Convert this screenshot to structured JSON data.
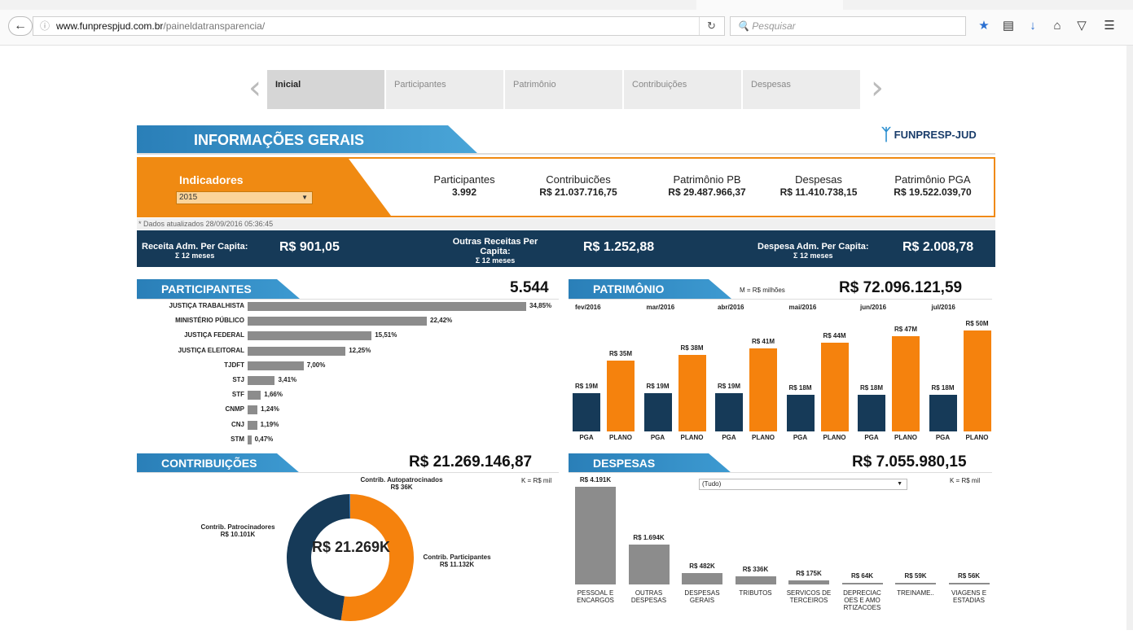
{
  "browser": {
    "url_host": "www.funprespjud.com.br",
    "url_path": "/paineldatransparencia/",
    "search_placeholder": "Pesquisar"
  },
  "nav": {
    "tabs": [
      "Inicial",
      "Participantes",
      "Patrimônio",
      "Contribuições",
      "Despesas"
    ],
    "active": "Inicial"
  },
  "header": {
    "title": "INFORMAÇÕES GERAIS",
    "logo": "FUNPRESP-JUD"
  },
  "indicators": {
    "label": "Indicadores",
    "year": "2015",
    "metrics": [
      {
        "label": "Participantes",
        "value": "3.992"
      },
      {
        "label": "Contribuicões",
        "value": "R$ 21.037.716,75"
      },
      {
        "label": "Patrimônio PB",
        "value": "R$ 29.487.966,37"
      },
      {
        "label": "Despesas",
        "value": "R$ 11.410.738,15"
      },
      {
        "label": "Patrimônio PGA",
        "value": "R$ 19.522.039,70"
      }
    ],
    "updated": "* Dados atualizados  28/09/2016 05:36:45"
  },
  "per_capita": {
    "receita_label": "Receita Adm. Per Capita:",
    "receita_sub": "Σ 12 meses",
    "receita_value": "R$ 901,05",
    "outras_label": "Outras Receitas Per Capita:",
    "outras_sub": "Σ 12 meses",
    "outras_value": "R$ 1.252,88",
    "despesa_label": "Despesa Adm. Per Capita:",
    "despesa_sub": "Σ 12 meses",
    "despesa_value": "R$ 2.008,78"
  },
  "participantes": {
    "title": "PARTICIPANTES",
    "total": "5.544",
    "chart_data": {
      "type": "bar",
      "categories": [
        "JUSTIÇA TRABALHISTA",
        "MINISTÉRIO PÚBLICO",
        "JUSTIÇA FEDERAL",
        "JUSTIÇA ELEITORAL",
        "TJDFT",
        "STJ",
        "STF",
        "CNMP",
        "CNJ",
        "STM"
      ],
      "values": [
        34.85,
        22.42,
        15.51,
        12.25,
        7.0,
        3.41,
        1.66,
        1.24,
        1.19,
        0.47
      ],
      "labels": [
        "34,85%",
        "22,42%",
        "15,51%",
        "12,25%",
        "7,00%",
        "3,41%",
        "1,66%",
        "1,24%",
        "1,19%",
        "0,47%"
      ]
    }
  },
  "patrimonio": {
    "title": "PATRIMÔNIO",
    "note": "M = R$ milhões",
    "total": "R$ 72.096.121,59",
    "chart_data": {
      "type": "bar",
      "categories": [
        "fev/2016",
        "mar/2016",
        "abr/2016",
        "mai/2016",
        "jun/2016",
        "jul/2016"
      ],
      "series": [
        {
          "name": "PGA",
          "values": [
            19,
            19,
            19,
            18,
            18,
            18
          ],
          "labels": [
            "R$ 19M",
            "R$ 19M",
            "R$ 19M",
            "R$ 18M",
            "R$ 18M",
            "R$ 18M"
          ],
          "color": "#163a58"
        },
        {
          "name": "PLANO",
          "values": [
            35,
            38,
            41,
            44,
            47,
            50
          ],
          "labels": [
            "R$ 35M",
            "R$ 38M",
            "R$ 41M",
            "R$ 44M",
            "R$ 47M",
            "R$ 50M"
          ],
          "color": "#f5820d"
        }
      ]
    }
  },
  "contribuicoes": {
    "title": "CONTRIBUIÇÕES",
    "total": "R$ 21.269.146,87",
    "note": "K = R$ mil",
    "center": "R$ 21.269K",
    "chart_data": {
      "type": "pie",
      "categories": [
        "Contrib. Participantes",
        "Contrib. Patrocinadores",
        "Contrib. Autopatrocinados"
      ],
      "values": [
        11132,
        10101,
        36
      ],
      "labels": [
        "R$ 11.132K",
        "R$ 10.101K",
        "R$ 36K"
      ],
      "colors": [
        "#f5820d",
        "#163a58",
        "#3a7cc0"
      ]
    }
  },
  "despesas": {
    "title": "DESPESAS",
    "total": "R$ 7.055.980,15",
    "note": "K = R$ mil",
    "filter": "(Tudo)",
    "chart_data": {
      "type": "bar",
      "categories": [
        "PESSOAL E ENCARGOS",
        "OUTRAS DESPESAS",
        "DESPESAS GERAIS",
        "TRIBUTOS",
        "SERVICOS DE TERCEIROS",
        "DEPRECIAC OES E AMO RTIZACOES",
        "TREINAME..",
        "VIAGENS E ESTADIAS"
      ],
      "values": [
        4191,
        1694,
        482,
        336,
        175,
        64,
        59,
        56
      ],
      "labels": [
        "R$ 4.191K",
        "R$ 1.694K",
        "R$ 482K",
        "R$ 336K",
        "R$ 175K",
        "R$ 64K",
        "R$ 59K",
        "R$ 56K"
      ]
    }
  }
}
